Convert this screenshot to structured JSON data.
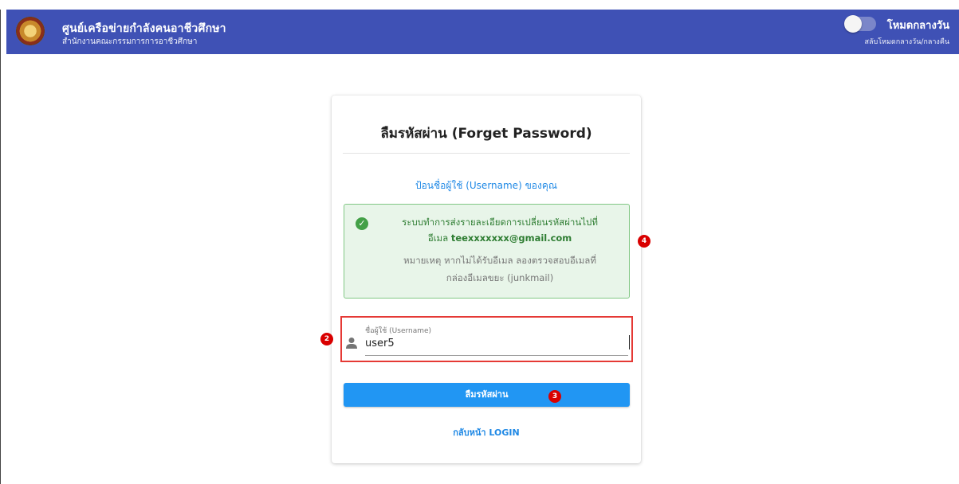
{
  "header": {
    "title": "ศูนย์เครือข่ายกำลังคนอาชีวศึกษา",
    "subtitle": "สำนักงานคณะกรรมการการอาชีวศึกษา",
    "mode_label": "โหมดกลางวัน",
    "mode_hint": "สลับโหมดกลางวัน/กลางคืน",
    "mode_toggle_on": false
  },
  "card": {
    "title": "ลืมรหัสผ่าน (Forget Password)",
    "subtitle": "ป้อนชื่อผู้ใช้ (Username) ของคุณ",
    "alert": {
      "icon": "check-circle-icon",
      "line1": "ระบบทำการส่งรายละเอียดการเปลี่ยนรหัสผ่านไปที่",
      "line2_prefix": "อีเมล",
      "email": "teexxxxxxx@gmail.com",
      "note1": "หมายเหตุ หากไม่ได้รับอีเมล ลองตรวจสอบอีเมลที่",
      "note2": "กล่องอีเมลขยะ (junkmail)",
      "colors": {
        "background": "#e8f5e9",
        "border": "#81c784",
        "text": "#2e7d32"
      }
    },
    "username_field": {
      "label": "ชื่อผู้ใช้ (Username)",
      "value": "user5",
      "icon": "user-icon"
    },
    "submit_label": "ลืมรหัสผ่าน",
    "back_link": "กลับหน้า LOGIN"
  },
  "markers": {
    "field": "2",
    "button": "3",
    "alert": "4"
  },
  "colors": {
    "header": "#3f51b5",
    "primary": "#2196f3",
    "highlight": "#e53935",
    "marker": "#d90000"
  }
}
